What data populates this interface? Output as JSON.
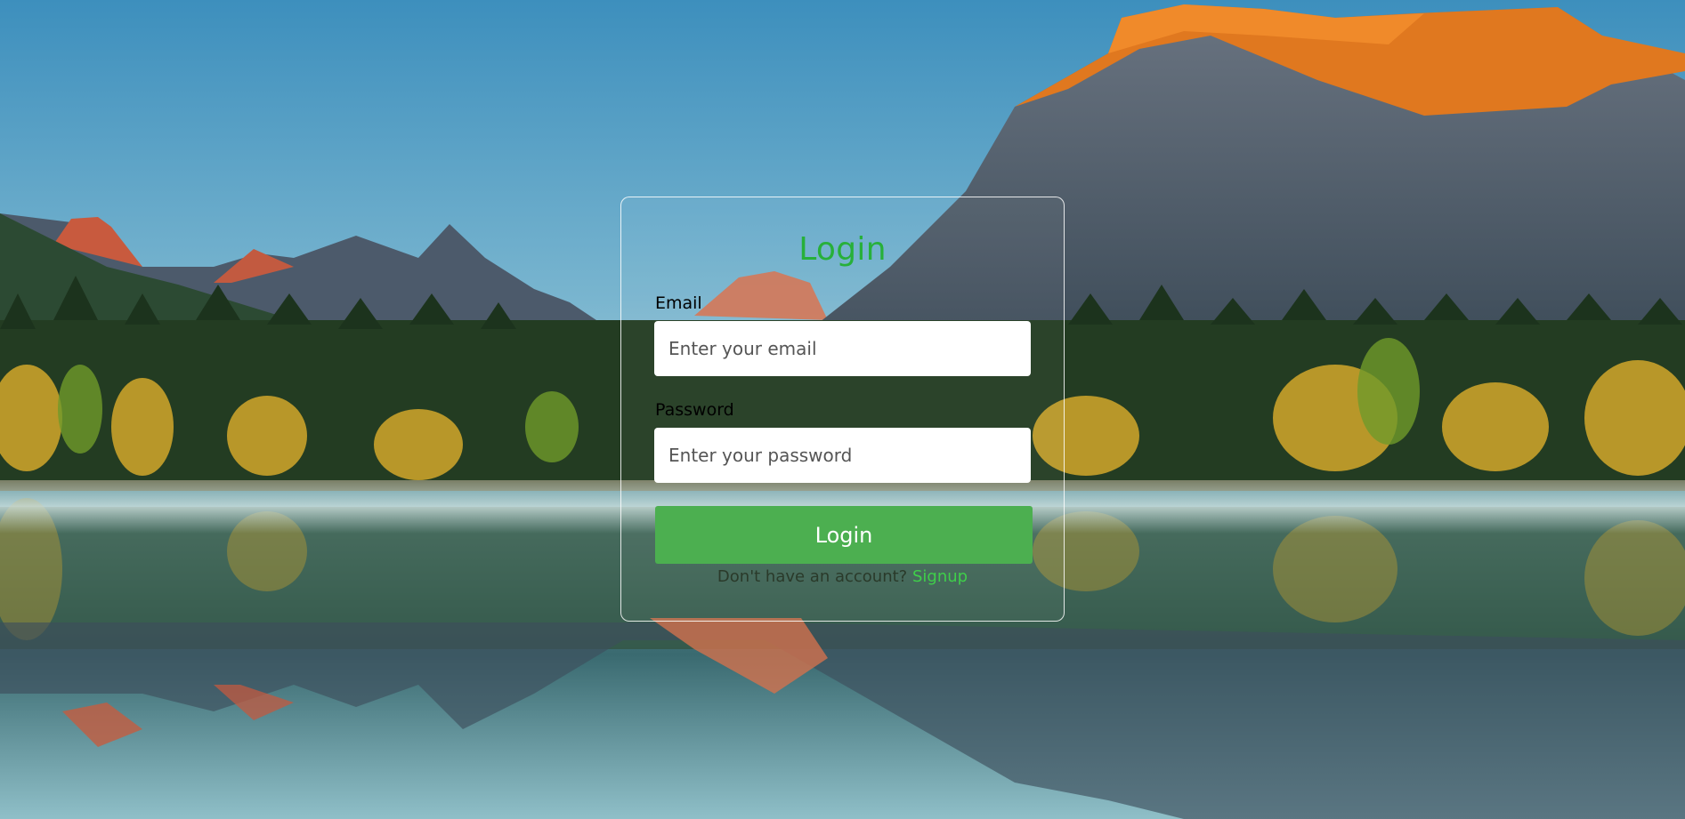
{
  "page": {
    "background": "mountain-lake-landscape"
  },
  "login": {
    "title": "Login",
    "email_label": "Email",
    "email_placeholder": "Enter your email",
    "password_label": "Password",
    "password_placeholder": "Enter your password",
    "button_label": "Login",
    "signup_prompt": "Don't have an account?",
    "signup_link": "Signup"
  },
  "colors": {
    "accent_green": "#4caf50",
    "title_green": "#27b03a",
    "link_green": "#3fcf4a"
  }
}
